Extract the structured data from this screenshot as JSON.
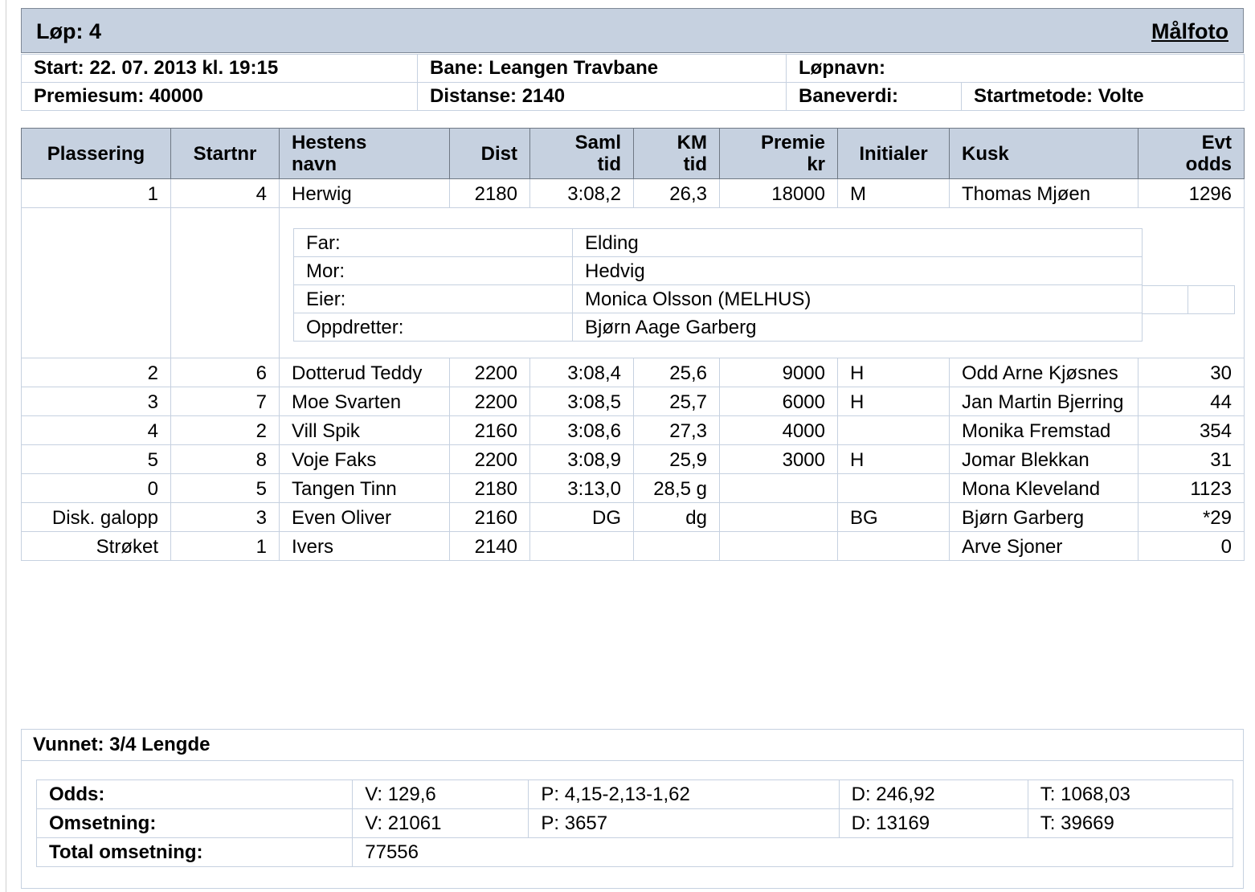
{
  "header": {
    "race_label": "Løp: 4",
    "photo_link": "Målfoto"
  },
  "info": {
    "start": "Start: 22. 07. 2013 kl. 19:15",
    "track": "Bane: Leangen Travbane",
    "race_name": "Løpnavn:",
    "prize_sum": "Premiesum: 40000",
    "distance": "Distanse: 2140",
    "track_value": "Baneverdi:",
    "start_method": "Startmetode: Volte"
  },
  "columns": {
    "placement": "Plassering",
    "start_no": "Startnr",
    "horse_1": "Hestens",
    "horse_2": "navn",
    "dist": "Dist",
    "total_time_1": "Saml",
    "total_time_2": "tid",
    "km_time_1": "KM",
    "km_time_2": "tid",
    "prize_1": "Premie",
    "prize_2": "kr",
    "initials": "Initialer",
    "driver": "Kusk",
    "odds_1": "Evt",
    "odds_2": "odds"
  },
  "rows": [
    {
      "place": "1",
      "start_no": "4",
      "horse": "Herwig",
      "dist": "2180",
      "time": "3:08,2",
      "km": "26,3",
      "prize": "18000",
      "initials": "M",
      "driver": "Thomas Mjøen",
      "odds": "1296"
    },
    {
      "place": "2",
      "start_no": "6",
      "horse": "Dotterud Teddy",
      "dist": "2200",
      "time": "3:08,4",
      "km": "25,6",
      "prize": "9000",
      "initials": "H",
      "driver": "Odd Arne Kjøsnes",
      "odds": "30"
    },
    {
      "place": "3",
      "start_no": "7",
      "horse": "Moe Svarten",
      "dist": "2200",
      "time": "3:08,5",
      "km": "25,7",
      "prize": "6000",
      "initials": "H",
      "driver": "Jan Martin Bjerring",
      "odds": "44"
    },
    {
      "place": "4",
      "start_no": "2",
      "horse": "Vill Spik",
      "dist": "2160",
      "time": "3:08,6",
      "km": "27,3",
      "prize": "4000",
      "initials": "",
      "driver": "Monika Fremstad",
      "odds": "354"
    },
    {
      "place": "5",
      "start_no": "8",
      "horse": "Voje Faks",
      "dist": "2200",
      "time": "3:08,9",
      "km": "25,9",
      "prize": "3000",
      "initials": "H",
      "driver": "Jomar Blekkan",
      "odds": "31"
    },
    {
      "place": "0",
      "start_no": "5",
      "horse": "Tangen Tinn",
      "dist": "2180",
      "time": "3:13,0",
      "km": "28,5 g",
      "prize": "",
      "initials": "",
      "driver": "Mona Kleveland",
      "odds": "1123"
    },
    {
      "place": "Disk. galopp",
      "start_no": "3",
      "horse": "Even Oliver",
      "dist": "2160",
      "time": "DG",
      "km": "dg",
      "prize": "",
      "initials": "BG",
      "driver": "Bjørn Garberg",
      "odds": "*29"
    },
    {
      "place": "Strøket",
      "start_no": "1",
      "horse": "Ivers",
      "dist": "2140",
      "time": "",
      "km": "",
      "prize": "",
      "initials": "",
      "driver": "Arve Sjoner",
      "odds": "0"
    }
  ],
  "pedigree": {
    "sire_label": "Far:",
    "sire": "Elding",
    "dam_label": "Mor:",
    "dam": "Hedvig",
    "owner_label": "Eier:",
    "owner": "Monica Olsson (MELHUS)",
    "breeder_label": "Oppdretter:",
    "breeder": "Bjørn Aage Garberg"
  },
  "summary": {
    "won_by": "Vunnet: 3/4 Lengde",
    "odds_label": "Odds:",
    "odds_v": "V: 129,6",
    "odds_p": "P: 4,15-2,13-1,62",
    "odds_d": "D: 246,92",
    "odds_t": "T: 1068,03",
    "turnover_label": "Omsetning:",
    "turnover_v": "V: 21061",
    "turnover_p": "P: 3657",
    "turnover_d": "D: 13169",
    "turnover_t": "T: 39669",
    "total_label": "Total omsetning:",
    "total": "77556"
  }
}
